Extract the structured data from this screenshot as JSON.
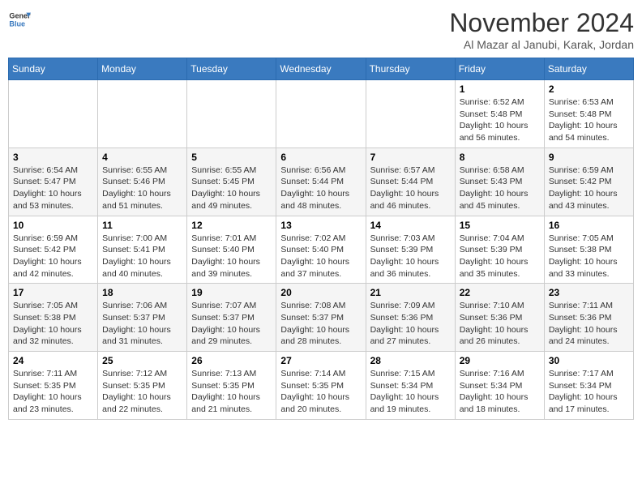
{
  "header": {
    "logo_line1": "General",
    "logo_line2": "Blue",
    "month": "November 2024",
    "location": "Al Mazar al Janubi, Karak, Jordan"
  },
  "days_of_week": [
    "Sunday",
    "Monday",
    "Tuesday",
    "Wednesday",
    "Thursday",
    "Friday",
    "Saturday"
  ],
  "weeks": [
    [
      {
        "num": "",
        "info": ""
      },
      {
        "num": "",
        "info": ""
      },
      {
        "num": "",
        "info": ""
      },
      {
        "num": "",
        "info": ""
      },
      {
        "num": "",
        "info": ""
      },
      {
        "num": "1",
        "info": "Sunrise: 6:52 AM\nSunset: 5:48 PM\nDaylight: 10 hours and 56 minutes."
      },
      {
        "num": "2",
        "info": "Sunrise: 6:53 AM\nSunset: 5:48 PM\nDaylight: 10 hours and 54 minutes."
      }
    ],
    [
      {
        "num": "3",
        "info": "Sunrise: 6:54 AM\nSunset: 5:47 PM\nDaylight: 10 hours and 53 minutes."
      },
      {
        "num": "4",
        "info": "Sunrise: 6:55 AM\nSunset: 5:46 PM\nDaylight: 10 hours and 51 minutes."
      },
      {
        "num": "5",
        "info": "Sunrise: 6:55 AM\nSunset: 5:45 PM\nDaylight: 10 hours and 49 minutes."
      },
      {
        "num": "6",
        "info": "Sunrise: 6:56 AM\nSunset: 5:44 PM\nDaylight: 10 hours and 48 minutes."
      },
      {
        "num": "7",
        "info": "Sunrise: 6:57 AM\nSunset: 5:44 PM\nDaylight: 10 hours and 46 minutes."
      },
      {
        "num": "8",
        "info": "Sunrise: 6:58 AM\nSunset: 5:43 PM\nDaylight: 10 hours and 45 minutes."
      },
      {
        "num": "9",
        "info": "Sunrise: 6:59 AM\nSunset: 5:42 PM\nDaylight: 10 hours and 43 minutes."
      }
    ],
    [
      {
        "num": "10",
        "info": "Sunrise: 6:59 AM\nSunset: 5:42 PM\nDaylight: 10 hours and 42 minutes."
      },
      {
        "num": "11",
        "info": "Sunrise: 7:00 AM\nSunset: 5:41 PM\nDaylight: 10 hours and 40 minutes."
      },
      {
        "num": "12",
        "info": "Sunrise: 7:01 AM\nSunset: 5:40 PM\nDaylight: 10 hours and 39 minutes."
      },
      {
        "num": "13",
        "info": "Sunrise: 7:02 AM\nSunset: 5:40 PM\nDaylight: 10 hours and 37 minutes."
      },
      {
        "num": "14",
        "info": "Sunrise: 7:03 AM\nSunset: 5:39 PM\nDaylight: 10 hours and 36 minutes."
      },
      {
        "num": "15",
        "info": "Sunrise: 7:04 AM\nSunset: 5:39 PM\nDaylight: 10 hours and 35 minutes."
      },
      {
        "num": "16",
        "info": "Sunrise: 7:05 AM\nSunset: 5:38 PM\nDaylight: 10 hours and 33 minutes."
      }
    ],
    [
      {
        "num": "17",
        "info": "Sunrise: 7:05 AM\nSunset: 5:38 PM\nDaylight: 10 hours and 32 minutes."
      },
      {
        "num": "18",
        "info": "Sunrise: 7:06 AM\nSunset: 5:37 PM\nDaylight: 10 hours and 31 minutes."
      },
      {
        "num": "19",
        "info": "Sunrise: 7:07 AM\nSunset: 5:37 PM\nDaylight: 10 hours and 29 minutes."
      },
      {
        "num": "20",
        "info": "Sunrise: 7:08 AM\nSunset: 5:37 PM\nDaylight: 10 hours and 28 minutes."
      },
      {
        "num": "21",
        "info": "Sunrise: 7:09 AM\nSunset: 5:36 PM\nDaylight: 10 hours and 27 minutes."
      },
      {
        "num": "22",
        "info": "Sunrise: 7:10 AM\nSunset: 5:36 PM\nDaylight: 10 hours and 26 minutes."
      },
      {
        "num": "23",
        "info": "Sunrise: 7:11 AM\nSunset: 5:36 PM\nDaylight: 10 hours and 24 minutes."
      }
    ],
    [
      {
        "num": "24",
        "info": "Sunrise: 7:11 AM\nSunset: 5:35 PM\nDaylight: 10 hours and 23 minutes."
      },
      {
        "num": "25",
        "info": "Sunrise: 7:12 AM\nSunset: 5:35 PM\nDaylight: 10 hours and 22 minutes."
      },
      {
        "num": "26",
        "info": "Sunrise: 7:13 AM\nSunset: 5:35 PM\nDaylight: 10 hours and 21 minutes."
      },
      {
        "num": "27",
        "info": "Sunrise: 7:14 AM\nSunset: 5:35 PM\nDaylight: 10 hours and 20 minutes."
      },
      {
        "num": "28",
        "info": "Sunrise: 7:15 AM\nSunset: 5:34 PM\nDaylight: 10 hours and 19 minutes."
      },
      {
        "num": "29",
        "info": "Sunrise: 7:16 AM\nSunset: 5:34 PM\nDaylight: 10 hours and 18 minutes."
      },
      {
        "num": "30",
        "info": "Sunrise: 7:17 AM\nSunset: 5:34 PM\nDaylight: 10 hours and 17 minutes."
      }
    ]
  ]
}
